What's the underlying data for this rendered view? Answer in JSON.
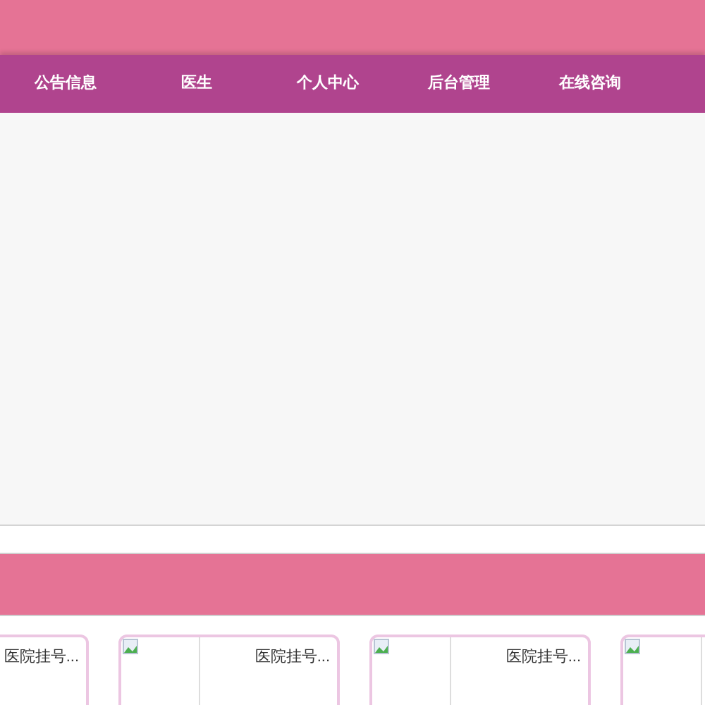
{
  "nav": {
    "items": [
      {
        "label": "公告信息"
      },
      {
        "label": "医生"
      },
      {
        "label": "个人中心"
      },
      {
        "label": "后台管理"
      },
      {
        "label": "在线咨询"
      }
    ]
  },
  "cards": [
    {
      "title": "医院挂号..."
    },
    {
      "image": true,
      "title": "医院挂号..."
    },
    {
      "image": true,
      "title": "医院挂号..."
    },
    {
      "image": true
    }
  ]
}
